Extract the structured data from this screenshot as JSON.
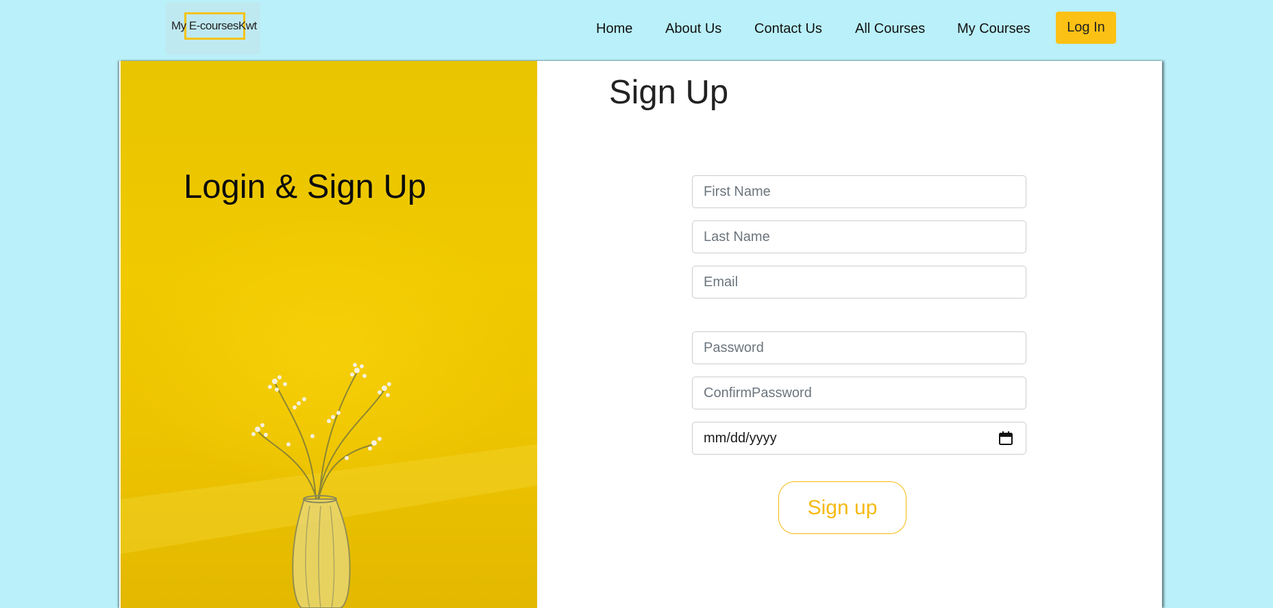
{
  "header": {
    "logo_text": "My E-coursesKwt",
    "nav": [
      "Home",
      "About Us",
      "Contact Us",
      "All Courses",
      "My Courses"
    ],
    "login_label": "Log In"
  },
  "left_panel": {
    "title": "Login & Sign Up"
  },
  "form": {
    "title": "Sign Up",
    "first_name_placeholder": "First Name",
    "last_name_placeholder": "Last Name",
    "email_placeholder": "Email",
    "password_placeholder": "Password",
    "confirm_password_placeholder": "ConfirmPassword",
    "date_placeholder": "mm/dd/yyyy",
    "submit_label": "Sign up"
  },
  "colors": {
    "page_background": "#b9f0f9",
    "accent": "#fcc115",
    "panel_yellow": "#f0c900"
  }
}
